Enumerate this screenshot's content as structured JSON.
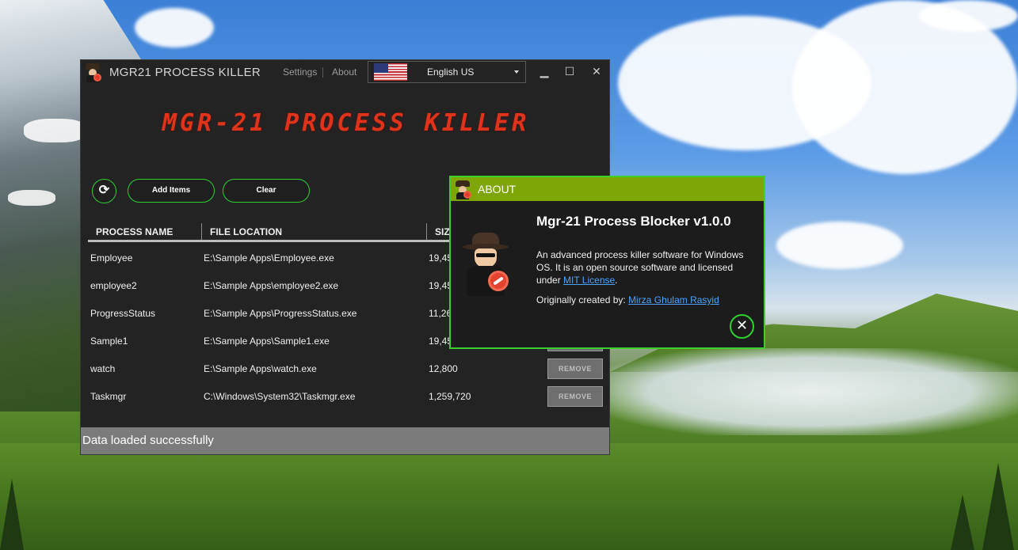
{
  "app": {
    "title": "MGR21 PROCESS KILLER",
    "settings_label": "Settings",
    "about_label": "About",
    "language": "English US",
    "banner": "MGR-21 PROCESS KILLER",
    "min_glyph": "▁",
    "max_glyph": "☐",
    "close_glyph": "✕"
  },
  "toolbar": {
    "refresh_glyph": "⟳",
    "add_label": "Add Items",
    "clear_label": "Clear"
  },
  "table": {
    "headers": [
      "PROCESS NAME",
      "FILE LOCATION",
      "SIZE"
    ],
    "rows": [
      {
        "name": "Employee",
        "location": "E:\\Sample Apps\\Employee.exe",
        "size": "19,45"
      },
      {
        "name": "employee2",
        "location": "E:\\Sample Apps\\employee2.exe",
        "size": "19,45"
      },
      {
        "name": "ProgressStatus",
        "location": "E:\\Sample Apps\\ProgressStatus.exe",
        "size": "11,26"
      },
      {
        "name": "Sample1",
        "location": "E:\\Sample Apps\\Sample1.exe",
        "size": "19,45"
      },
      {
        "name": "watch",
        "location": "E:\\Sample Apps\\watch.exe",
        "size": "12,800"
      },
      {
        "name": "Taskmgr",
        "location": "C:\\Windows\\System32\\Taskmgr.exe",
        "size": "1,259,720"
      }
    ],
    "remove_label": "REMOVE"
  },
  "status": {
    "message": "Data loaded successfully"
  },
  "about": {
    "title": "ABOUT",
    "heading": "Mgr-21 Process Blocker v1.0.0",
    "desc_prefix": "An advanced process killer software for Windows OS. It is an open source software and licensed under ",
    "license_link": "MIT License",
    "desc_suffix": ".",
    "credit_prefix": "Originally created by: ",
    "author_link": "Mirza Ghulam Rasyid",
    "close_glyph": "✕"
  },
  "colors": {
    "accent_green": "#2fd12f",
    "about_header": "#7fa607",
    "banner_red": "#e0331c",
    "window_bg": "#232323"
  }
}
